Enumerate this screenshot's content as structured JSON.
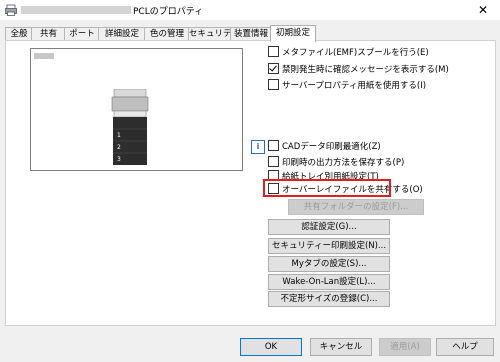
{
  "window": {
    "title": "PCLのプロパティ",
    "close_glyph": "✕"
  },
  "tabs": [
    {
      "label": "全般"
    },
    {
      "label": "共有"
    },
    {
      "label": "ポート"
    },
    {
      "label": "詳細設定"
    },
    {
      "label": "色の管理"
    },
    {
      "label": "セキュリティ"
    },
    {
      "label": "装置情報"
    },
    {
      "label": "初期設定"
    }
  ],
  "active_tab": "初期設定",
  "options": {
    "emf_spool": {
      "label": "メタファイル(EMF)スプールを行う(E)",
      "checked": false
    },
    "confirm_prohibit": {
      "label": "禁則発生時に確認メッセージを表示する(M)",
      "checked": true
    },
    "server_property": {
      "label": "サーバープロパティ用紙を使用する(I)",
      "checked": false
    },
    "cad_optimize": {
      "label": "CADデータ印刷最適化(Z)",
      "checked": false
    },
    "save_output_method": {
      "label": "印刷時の出力方法を保存する(P)",
      "checked": false
    },
    "tray_paper_setting": {
      "label": "給紙トレイ別用紙設定(T)",
      "checked": false
    },
    "share_overlay": {
      "label": "オーバーレイファイルを共有する(O)",
      "checked": false
    }
  },
  "info_icon_glyph": "i",
  "buttons": {
    "shared_folder": "共有フォルダーの設定(F)...",
    "auth": "認証設定(G)...",
    "security_print": "セキュリティー印刷設定(N)...",
    "mytab": "Myタブの設定(S)...",
    "wake_on_lan": "Wake-On-Lan設定(L)...",
    "custom_size": "不定形サイズの登録(C)..."
  },
  "dialog": {
    "ok": "OK",
    "cancel": "キャンセル",
    "apply": "適用(A)",
    "help": "ヘルプ"
  },
  "colors": {
    "highlight": "#e02020",
    "info_icon": "#2b6cd4"
  }
}
